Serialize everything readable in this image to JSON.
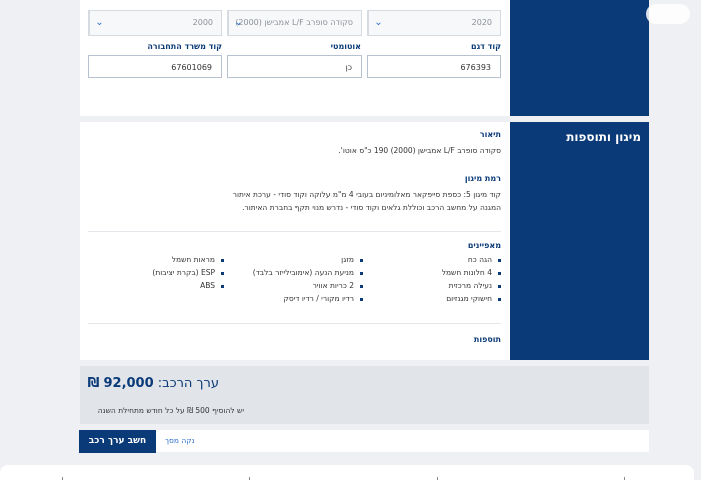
{
  "selects": [
    {
      "value": "2020"
    },
    {
      "value": "סקודה סופרב L/F אמבישן (2000)"
    },
    {
      "value": "2000"
    }
  ],
  "fields": [
    {
      "label": "קוד דגם",
      "value": "676393"
    },
    {
      "label": "אוטומטי",
      "value": "כן"
    },
    {
      "label": "קוד משרד התחבורה",
      "value": "67601069"
    }
  ],
  "side_title": "מיגון ותוספות",
  "description": {
    "title": "תיאור",
    "text": "סקודה סופרב L/F אמבישן (2000) 190 כ\"ס אוטו'."
  },
  "protection": {
    "title": "רמת מיגון",
    "line1": "קוד מיגון 5: כספת סייפקאר מאלומיניום בעובי 4 מ\"מ עלוקה וקוד סודי - ערכת איתור",
    "line2": "המגנה על מחשב הרכב וכוללת גלאים וקוד סודי - נדרש מנוי תקף בחברת האיתור."
  },
  "features": {
    "title": "מאפיינים",
    "col1": [
      "הגה כח",
      "4 חלונות חשמל",
      "נעילה מרכזית",
      "חישוקי מגנזיום"
    ],
    "col2": [
      "מזגן",
      "מניעת הנעה (אימובילייזר בלבד)",
      "2 כריות אוויר",
      "רדיו מקורי / רדיו דיסק"
    ],
    "col3": [
      "מראות חשמל",
      "ESP (בקרת יציבות)",
      "ABS"
    ]
  },
  "extras": {
    "title": "תוספות"
  },
  "value": {
    "label": "ערך הרכב:",
    "amount": "92,000",
    "currency": "₪",
    "note": "יש להוסיף 500 ₪ על כל חודש מתחילת השנה"
  },
  "buttons": {
    "calc": "חשב ערך רכב",
    "clear": "נקה מסך"
  },
  "colors": {
    "accent": "#0a3a78",
    "link": "#2a6fc9"
  }
}
